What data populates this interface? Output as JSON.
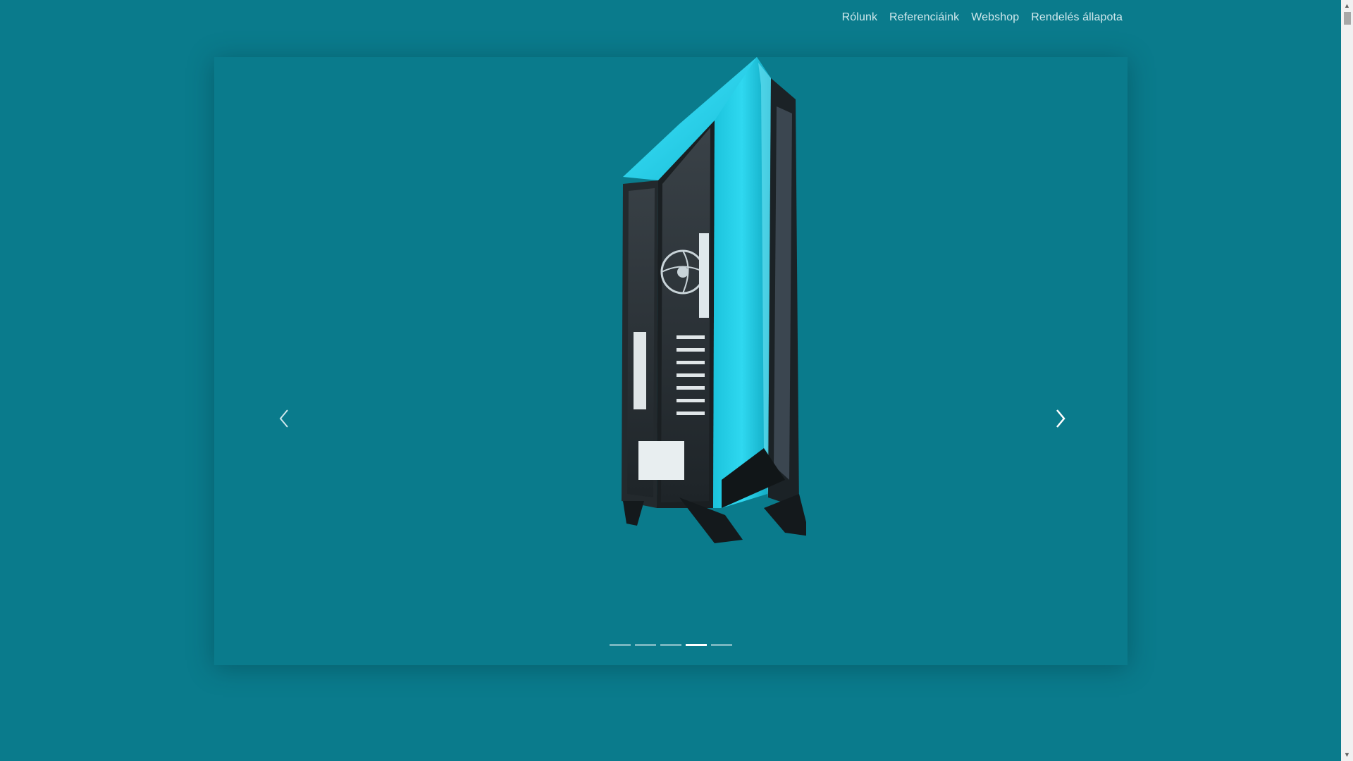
{
  "nav": {
    "items": [
      {
        "label": "Rólunk"
      },
      {
        "label": "Referenciáink"
      },
      {
        "label": "Webshop"
      },
      {
        "label": "Rendelés állapota"
      }
    ]
  },
  "carousel": {
    "slide_image": "pc-case-icon",
    "slide_count": 5,
    "active_index": 3,
    "prev_icon": "chevron-left-icon",
    "next_icon": "chevron-right-icon"
  },
  "colors": {
    "background": "#0a7b8c",
    "accent": "#2fd8f0",
    "nav_text": "#cfe8ec"
  }
}
